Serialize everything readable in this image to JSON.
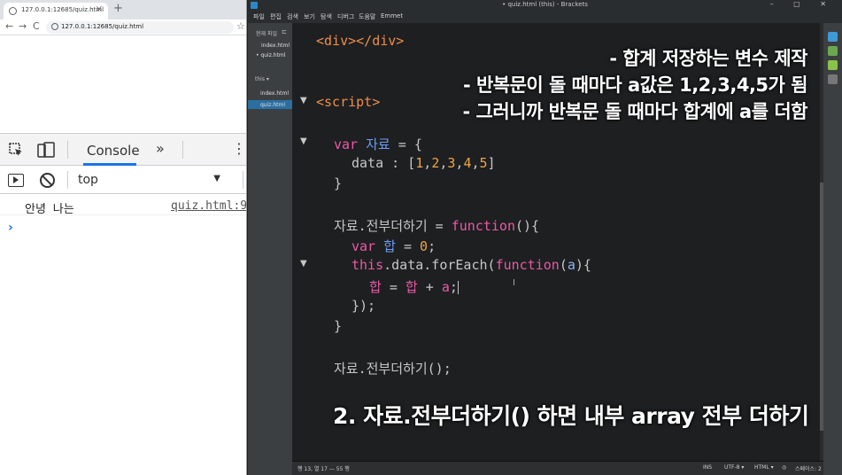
{
  "browser": {
    "tab_title": "127.0.0.1:12685/quiz.html",
    "tab_close": "×",
    "new_tab": "+",
    "back": "←",
    "forward": "→",
    "reload": "C",
    "url": "127.0.0.1:12685/quiz.html",
    "bookmark": "☆"
  },
  "devtools": {
    "console_tab": "Console",
    "more_tabs": "»",
    "kebab": "⋮",
    "context": "top",
    "context_arrow": "▼",
    "log": {
      "text": "안녕 나는",
      "source": "quiz.html:9"
    },
    "prompt": "›"
  },
  "brackets": {
    "window_title": "• quiz.html (this) - Brackets",
    "window_controls": "– ▢ ✕",
    "menu": [
      "파일",
      "편집",
      "검색",
      "보기",
      "탐색",
      "디버그",
      "도움말",
      "Emmet"
    ],
    "sidebar": {
      "working_files_label": "현재 파일",
      "working_files_icon": "⊏",
      "working_files": [
        "index.html",
        "• quiz.html"
      ],
      "project_label": "this ▾",
      "project_files": [
        "index.html",
        "quiz.html"
      ]
    },
    "code_lines": [
      "<div></div>",
      "<script>",
      "var 자료 = {",
      "data : [1,2,3,4,5]",
      "}",
      "자료.전부더하기 = function(){",
      "var 합 = 0;",
      "this.data.forEach(function(a){",
      "합 = 합 + a;",
      "});",
      "}",
      "자료.전부더하기();"
    ],
    "fold_marker": "▼",
    "overlay": {
      "line1": "- 합계 저장하는 변수 제작",
      "line2": "- 반복문이 돌 때마다 a값은 1,2,3,4,5가 됨",
      "line3": "- 그러니까 반복문 돌 때마다 합계에 a를 더함",
      "bottom": "2. 자료.전부더하기() 하면 내부 array 전부 더하기"
    },
    "status": {
      "position": "행 13, 열 17 — 55 행",
      "mode": "INS",
      "encoding": "UTF-8 ▾",
      "language": "HTML ▾",
      "spaces": "스페이스: 2"
    },
    "colors": {
      "tag": "#f08d49",
      "keyword": "#ea59a6",
      "variable": "#6e9cf0",
      "number": "#f0a545",
      "background": "#1d1f21"
    }
  }
}
